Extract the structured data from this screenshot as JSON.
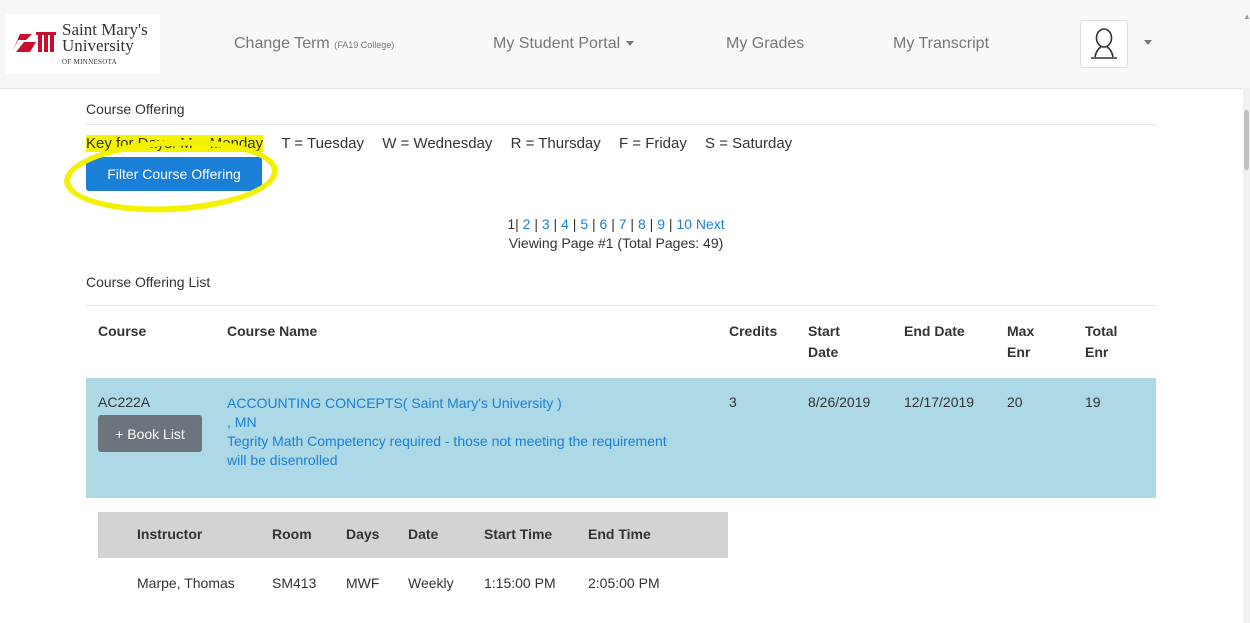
{
  "nav": {
    "logo": {
      "line1": "Saint Mary's",
      "line2": "University",
      "line3": "OF MINNESOTA"
    },
    "change_term_label": "Change Term",
    "change_term_code": "(FA19 College)",
    "portal_label": "My Student Portal",
    "grades_label": "My Grades",
    "transcript_label": "My Transcript",
    "user_icon": "user-icon",
    "scroll_indicator": "▲"
  },
  "course_offering": {
    "title": "Course Offering",
    "key_prefix": "Key for Days: M = Monday",
    "key_items": [
      "T = Tuesday",
      "W = Wednesday",
      "R = Thursday",
      "F = Friday",
      "S = Saturday"
    ],
    "filter_button": "Filter Course Offering",
    "highlight_color": "#f2f200"
  },
  "pager": {
    "current": "1",
    "pages": [
      "2",
      "3",
      "4",
      "5",
      "6",
      "7",
      "8",
      "9",
      "10"
    ],
    "next_label": "Next",
    "status": "Viewing Page #1 (Total Pages: 49)"
  },
  "list": {
    "title": "Course Offering List",
    "headers": {
      "course": "Course",
      "course_name": "Course Name",
      "credits": "Credits",
      "start_date": [
        "Start",
        "Date"
      ],
      "end_date": "End Date",
      "max_enr": [
        "Max",
        "Enr"
      ],
      "total_enr": [
        "Total",
        "Enr"
      ]
    },
    "row": {
      "course": "AC222A",
      "book_button": "+ Book List",
      "name_line1": "ACCOUNTING CONCEPTS( Saint Mary's University )",
      "name_line2": ", MN",
      "note": "Tegrity Math Competency required - those not meeting the requirement will be disenrolled",
      "credits": "3",
      "start_date": "8/26/2019",
      "end_date": "12/17/2019",
      "max_enr": "20",
      "total_enr": "19",
      "row_color": "#add8e6"
    }
  },
  "schedule": {
    "headers": [
      "Instructor",
      "Room",
      "Days",
      "Date",
      "Start Time",
      "End Time"
    ],
    "row": [
      "Marpe, Thomas",
      "SM413",
      "MWF",
      "Weekly",
      "1:15:00 PM",
      "2:05:00 PM"
    ]
  }
}
